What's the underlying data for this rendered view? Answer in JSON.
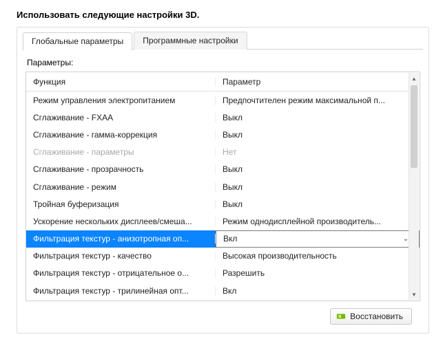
{
  "header": "Использовать следующие настройки 3D.",
  "tabs": {
    "global": "Глобальные параметры",
    "program": "Программные настройки"
  },
  "params_label": "Параметры:",
  "columns": {
    "func": "Функция",
    "param": "Параметр"
  },
  "rows": [
    {
      "func": "Режим управления электропитанием",
      "param": "Предпочтителен режим максимальной п...",
      "disabled": false,
      "selected": false
    },
    {
      "func": "Сглаживание - FXAA",
      "param": "Выкл",
      "disabled": false,
      "selected": false
    },
    {
      "func": "Сглаживание - гамма-коррекция",
      "param": "Выкл",
      "disabled": false,
      "selected": false
    },
    {
      "func": "Сглаживание - параметры",
      "param": "Нет",
      "disabled": true,
      "selected": false
    },
    {
      "func": "Сглаживание - прозрачность",
      "param": "Выкл",
      "disabled": false,
      "selected": false
    },
    {
      "func": "Сглаживание - режим",
      "param": "Выкл",
      "disabled": false,
      "selected": false
    },
    {
      "func": "Тройная буферизация",
      "param": "Выкл",
      "disabled": false,
      "selected": false
    },
    {
      "func": "Ускорение нескольких дисплеев/смеша...",
      "param": "Режим однодисплейной производитель...",
      "disabled": false,
      "selected": false
    },
    {
      "func": "Фильтрация текстур - анизотропная оп...",
      "param": "Вкл",
      "disabled": false,
      "selected": true
    },
    {
      "func": "Фильтрация текстур - качество",
      "param": "Высокая производительность",
      "disabled": false,
      "selected": false
    },
    {
      "func": "Фильтрация текстур - отрицательное о...",
      "param": "Разрешить",
      "disabled": false,
      "selected": false
    },
    {
      "func": "Фильтрация текстур - трилинейная опт...",
      "param": "Вкл",
      "disabled": false,
      "selected": false
    }
  ],
  "restore_label": "Восстановить"
}
